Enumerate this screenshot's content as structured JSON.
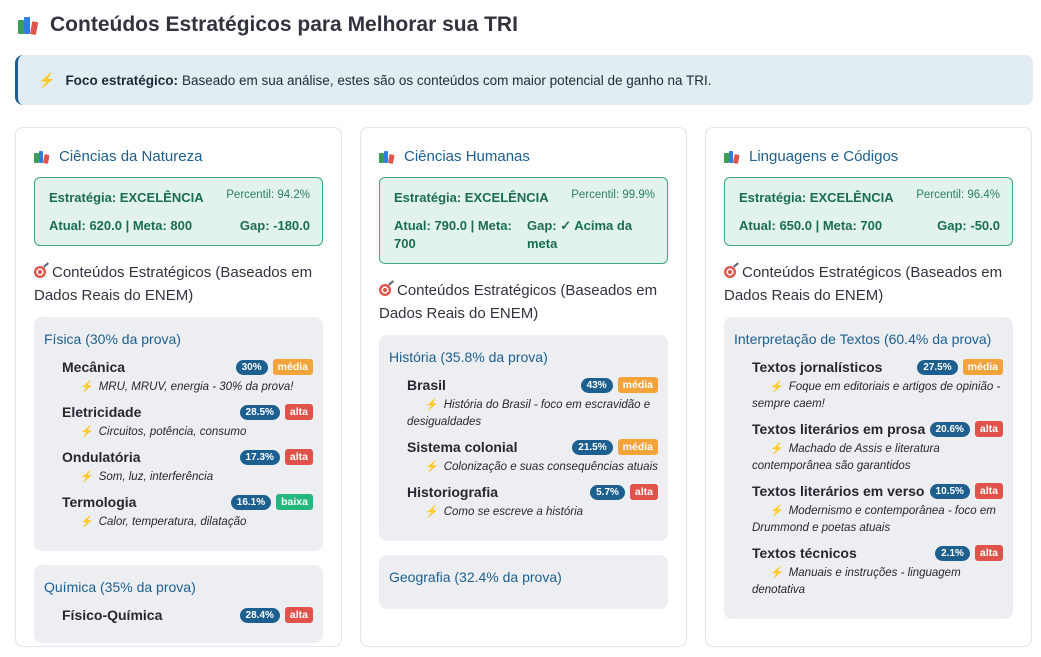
{
  "title": "Conteúdos Estratégicos para Melhorar sua TRI",
  "alert": {
    "bold": "Foco estratégico:",
    "text": "Baseado em sua análise, estes são os conteúdos com maior potencial de ganho na TRI."
  },
  "strategic_heading": "Conteúdos Estratégicos (Baseados em Dados Reais do ENEM)",
  "colors": {
    "accent": "#1d5f8e",
    "green": "#1a6d4e",
    "media": "#f2a33a",
    "alta": "#e0534a",
    "baixa": "#25b87e"
  },
  "cards": [
    {
      "title": "Ciências da Natureza",
      "strategy": "Estratégia: EXCELÊNCIA",
      "percentil": "Percentil: 94.2%",
      "atual_meta": "Atual: 620.0 | Meta: 800",
      "gap": "Gap: -180.0",
      "subjects": [
        {
          "title": "Física (30% da prova)",
          "topics": [
            {
              "name": "Mecânica",
              "pct": "30%",
              "level": "média",
              "desc": "MRU, MRUV, energia - 30% da prova!"
            },
            {
              "name": "Eletricidade",
              "pct": "28.5%",
              "level": "alta",
              "desc": "Circuitos, potência, consumo"
            },
            {
              "name": "Ondulatória",
              "pct": "17.3%",
              "level": "alta",
              "desc": "Som, luz, interferência"
            },
            {
              "name": "Termologia",
              "pct": "16.1%",
              "level": "baixa",
              "desc": "Calor, temperatura, dilatação"
            }
          ]
        },
        {
          "title": "Química (35% da prova)",
          "topics": [
            {
              "name": "Físico-Química",
              "pct": "28.4%",
              "level": "alta",
              "desc": ""
            }
          ]
        }
      ]
    },
    {
      "title": "Ciências Humanas",
      "strategy": "Estratégia: EXCELÊNCIA",
      "percentil": "Percentil: 99.9%",
      "atual_meta": "Atual: 790.0 | Meta: 700",
      "gap": "Gap: ✓ Acima da meta",
      "subjects": [
        {
          "title": "História (35.8% da prova)",
          "topics": [
            {
              "name": "Brasil",
              "pct": "43%",
              "level": "média",
              "desc": "História do Brasil - foco em escravidão e desigualdades"
            },
            {
              "name": "Sistema colonial",
              "pct": "21.5%",
              "level": "média",
              "desc": "Colonização e suas consequências atuais"
            },
            {
              "name": "Historiografia",
              "pct": "5.7%",
              "level": "alta",
              "desc": "Como se escreve a história"
            }
          ]
        },
        {
          "title": "Geografia (32.4% da prova)",
          "topics": []
        }
      ]
    },
    {
      "title": "Linguagens e Códigos",
      "strategy": "Estratégia: EXCELÊNCIA",
      "percentil": "Percentil: 96.4%",
      "atual_meta": "Atual: 650.0 | Meta: 700",
      "gap": "Gap: -50.0",
      "subjects": [
        {
          "title": "Interpretação de Textos (60.4% da prova)",
          "topics": [
            {
              "name": "Textos jornalísticos",
              "pct": "27.5%",
              "level": "média",
              "desc": "Foque em editoriais e artigos de opinião - sempre caem!"
            },
            {
              "name": "Textos literários em prosa",
              "pct": "20.6%",
              "level": "alta",
              "desc": "Machado de Assis e literatura contemporânea são garantidos"
            },
            {
              "name": "Textos literários em verso",
              "pct": "10.5%",
              "level": "alta",
              "desc": "Modernismo e contemporânea - foco em Drummond e poetas atuais"
            },
            {
              "name": "Textos técnicos",
              "pct": "2.1%",
              "level": "alta",
              "desc": "Manuais e instruções - linguagem denotativa"
            }
          ]
        }
      ]
    }
  ]
}
